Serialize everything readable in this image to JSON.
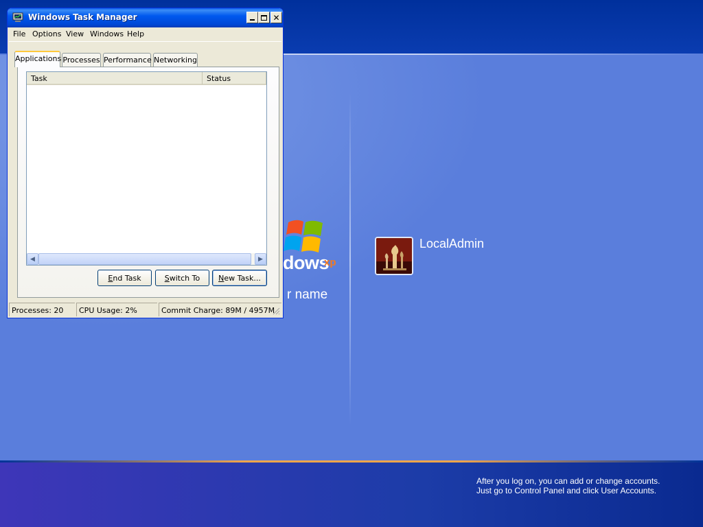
{
  "logon": {
    "logo_word": "dows",
    "logo_sup": "xp",
    "prompt": "r name",
    "user_name": "LocalAdmin",
    "hint_line1": "After you log on, you can add or change accounts.",
    "hint_line2": "Just go to Control Panel and click User Accounts.",
    "colors": {
      "background": "#5a7edc",
      "top_band": "#00309c",
      "accent_line": "#f4a64a"
    }
  },
  "task_manager": {
    "title": "Windows Task Manager",
    "caption_buttons": {
      "minimize_icon": "minimize-icon",
      "maximize_icon": "maximize-icon",
      "close_icon": "close-icon"
    },
    "menu": [
      "File",
      "Options",
      "View",
      "Windows",
      "Help"
    ],
    "tabs": [
      "Applications",
      "Processes",
      "Performance",
      "Networking"
    ],
    "active_tab": "Applications",
    "list": {
      "columns": [
        "Task",
        "Status"
      ],
      "rows": []
    },
    "buttons": {
      "end_task": {
        "mnemonic": "E",
        "rest": "nd Task"
      },
      "switch_to": {
        "mnemonic": "S",
        "rest": "witch To"
      },
      "new_task": {
        "mnemonic": "N",
        "rest": "ew Task..."
      }
    },
    "status": {
      "processes": "Processes: 20",
      "cpu": "CPU Usage: 2%",
      "commit": "Commit Charge: 89M / 4957M"
    }
  }
}
